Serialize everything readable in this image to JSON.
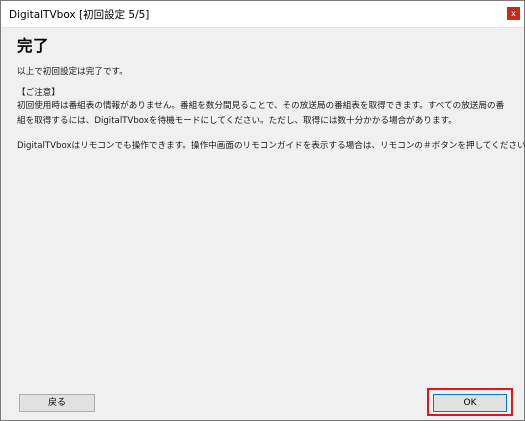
{
  "window": {
    "title": "DigitalTVbox [初回設定 5/5]",
    "close_label": "x"
  },
  "main": {
    "heading": "完了",
    "intro": "以上で初回設定は完了です。",
    "notice_heading": "【ご注意】",
    "notice_line1": "初回使用時は番組表の情報がありません。番組を数分間見ることで、その放送局の番組表を取得できます。すべての放送局の番",
    "notice_line2": "組を取得するには、DigitalTVboxを待機モードにしてください。ただし、取得には数十分かかる場合があります。",
    "remote_note": "DigitalTVboxはリモコンでも操作できます。操作中画面のリモコンガイドを表示する場合は、リモコンの＃ボタンを押してください。"
  },
  "footer": {
    "back_label": "戻る",
    "ok_label": "OK"
  },
  "colors": {
    "highlight": "#e0161a",
    "close_button": "#c42b1c"
  }
}
